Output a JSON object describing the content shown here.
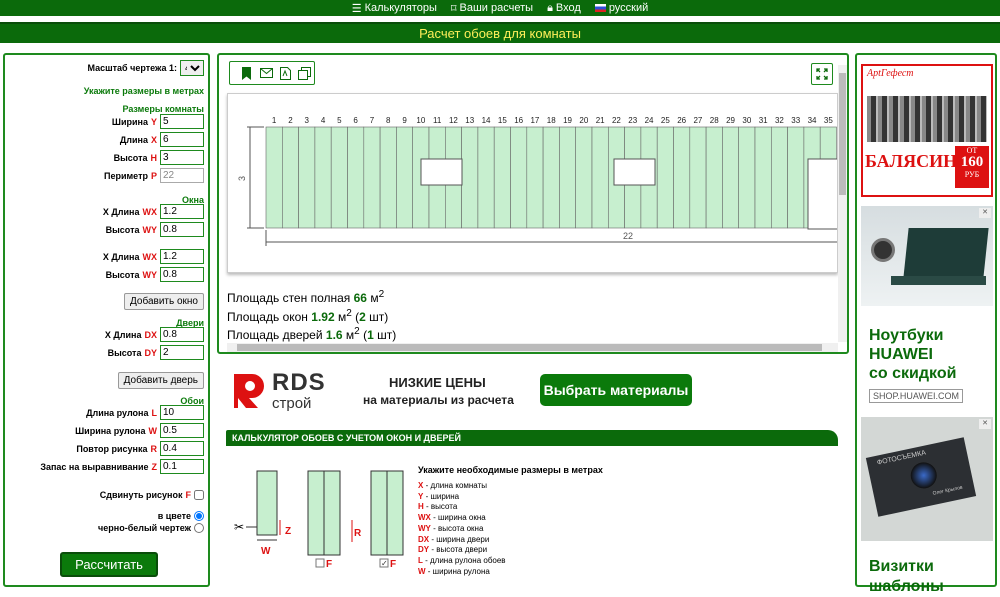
{
  "nav": {
    "calculators": "Калькуляторы",
    "your_calcs": "Ваши расчеты",
    "login": "Вход",
    "language": "русский"
  },
  "page_title": "Расчет обоев для комнаты",
  "left": {
    "scale_label": "Масштаб чертежа 1:",
    "scale_value": "4",
    "hint": "Укажите размеры в метрах",
    "room_section": "Размеры комнаты",
    "width_label": "Ширина",
    "width_var": "Y",
    "width_value": "5",
    "length_label": "Длина",
    "length_var": "X",
    "length_value": "6",
    "height_label": "Высота",
    "height_var": "H",
    "height_value": "3",
    "perimeter_label": "Периметр",
    "perimeter_var": "P",
    "perimeter_value": "22",
    "windows_section": "Окна",
    "win_len_label": "X Длина",
    "win_len_var": "WX",
    "win_height_label": "Высота",
    "win_height_var": "WY",
    "window1_len": "1.2",
    "window1_height": "0.8",
    "window2_len": "1.2",
    "window2_height": "0.8",
    "add_window": "Добавить окно",
    "doors_section": "Двери",
    "door_len_label": "X Длина",
    "door_len_var": "DX",
    "door_len_value": "0.8",
    "door_height_label": "Высота",
    "door_height_var": "DY",
    "door_height_value": "2",
    "add_door": "Добавить дверь",
    "wallpaper_section": "Обои",
    "roll_length_label": "Длина рулона",
    "roll_length_var": "L",
    "roll_length_value": "10",
    "roll_width_label": "Ширина рулона",
    "roll_width_var": "W",
    "roll_width_value": "0.5",
    "repeat_label": "Повтор рисунка",
    "repeat_var": "R",
    "repeat_value": "0.4",
    "margin_label": "Запас на выравнивание",
    "margin_var": "Z",
    "margin_value": "0.1",
    "shift_label": "Сдвинуть рисунок",
    "shift_var": "F",
    "color_label": "в цвете",
    "bw_label": "черно-белый чертеж",
    "calculate": "Рассчитать"
  },
  "drawing": {
    "columns": [
      "1",
      "2",
      "3",
      "4",
      "5",
      "6",
      "7",
      "8",
      "9",
      "10",
      "11",
      "12",
      "13",
      "14",
      "15",
      "16",
      "17",
      "18",
      "19",
      "20",
      "21",
      "22",
      "23",
      "24",
      "25",
      "26",
      "27",
      "28",
      "29",
      "30",
      "31",
      "32",
      "33",
      "34",
      "35"
    ],
    "height_label": "3",
    "perimeter_label": "22"
  },
  "stats": {
    "walls_label": "Площадь стен полная",
    "walls_value": "66",
    "windows_label": "Площадь окон",
    "windows_value": "1.92",
    "windows_count": "2",
    "doors_label": "Площадь дверей",
    "doors_value": "1.6",
    "doors_count": "1",
    "unit": "м",
    "pcs": "шт"
  },
  "ad": {
    "brand_top": "RDS",
    "brand_bottom": "строй",
    "line1": "НИЗКИЕ ЦЕНЫ",
    "line2": "на материалы из расчета",
    "button": "Выбрать материалы"
  },
  "guide": {
    "header": "КАЛЬКУЛЯТОР ОБОЕВ С УЧЕТОМ ОКОН И ДВЕРЕЙ",
    "intro": "Укажите необходимые размеры в метрах",
    "items": [
      {
        "key": "X",
        "text": " - длина комнаты"
      },
      {
        "key": "Y",
        "text": " - ширина"
      },
      {
        "key": "H",
        "text": " - высота"
      },
      {
        "key": "WX",
        "text": " - ширина окна"
      },
      {
        "key": "WY",
        "text": " - высота окна"
      },
      {
        "key": "DX",
        "text": " - ширина двери"
      },
      {
        "key": "DY",
        "text": " - высота двери"
      },
      {
        "key": "L",
        "text": " - длина рулона обоев"
      },
      {
        "key": "W",
        "text": " - ширина рулона"
      }
    ],
    "z": "Z",
    "w": "W",
    "r": "R",
    "f": "F"
  },
  "right_ads": {
    "ad1_brand": "АрtГефест",
    "ad1_text": "БАЛЯСИНЫ",
    "ad1_from": "ОТ",
    "ad1_price": "160",
    "ad1_cur": "РУБ",
    "ad2_line1": "Ноутбуки",
    "ad2_line2": "HUAWEI",
    "ad2_line3": "со скидкой",
    "ad2_url": "SHOP.HUAWEI.COM",
    "ad3_card_title": "ФОТОСЪЕМКА",
    "ad3_card_name": "Олег Крылов",
    "ad3_line1": "Визитки",
    "ad3_line2": "шаблоны"
  },
  "colors": {
    "brand_green": "#0b6a0b",
    "accent_red": "#dd1111",
    "title_yellow": "#ffef5a"
  }
}
